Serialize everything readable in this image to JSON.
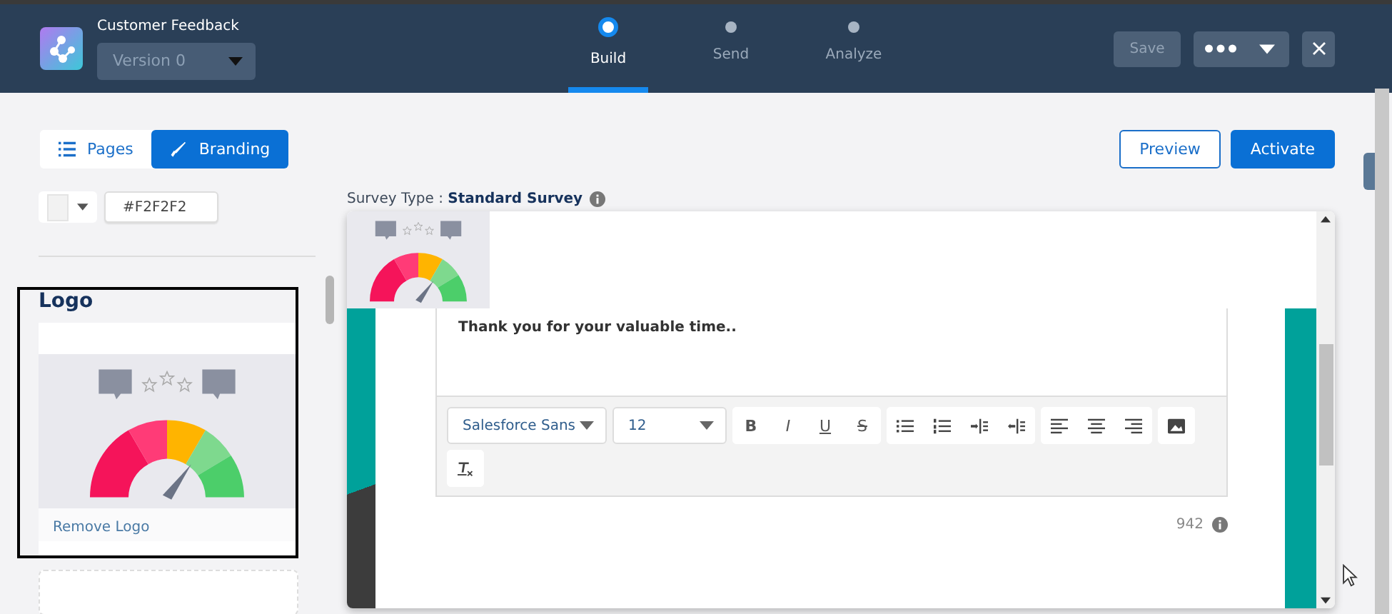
{
  "header": {
    "title": "Customer Feedback",
    "version": "Version 0"
  },
  "steps": [
    {
      "label": "Build",
      "selected": true
    },
    {
      "label": "Send",
      "selected": false
    },
    {
      "label": "Analyze",
      "selected": false
    }
  ],
  "save_button": {
    "label": "Save",
    "disabled": true
  },
  "mode_tabs": [
    {
      "label": "Pages",
      "selected": false
    },
    {
      "label": "Branding",
      "selected": true
    }
  ],
  "actions": [
    {
      "label": "Preview",
      "kind": "outline"
    },
    {
      "label": "Activate",
      "kind": "brand"
    }
  ],
  "color_field": {
    "value": "#F2F2F2"
  },
  "logo_section": {
    "title": "Logo",
    "remove_link": "Remove Logo"
  },
  "survey_type": "Survey Type : **Standard Survey**",
  "preview": {
    "message": "Thank you for your valuable time..",
    "font": "Salesforce Sans",
    "size": "12",
    "format_buttons": [
      "B",
      "I",
      "U",
      "S"
    ],
    "char_count": "942"
  }
}
